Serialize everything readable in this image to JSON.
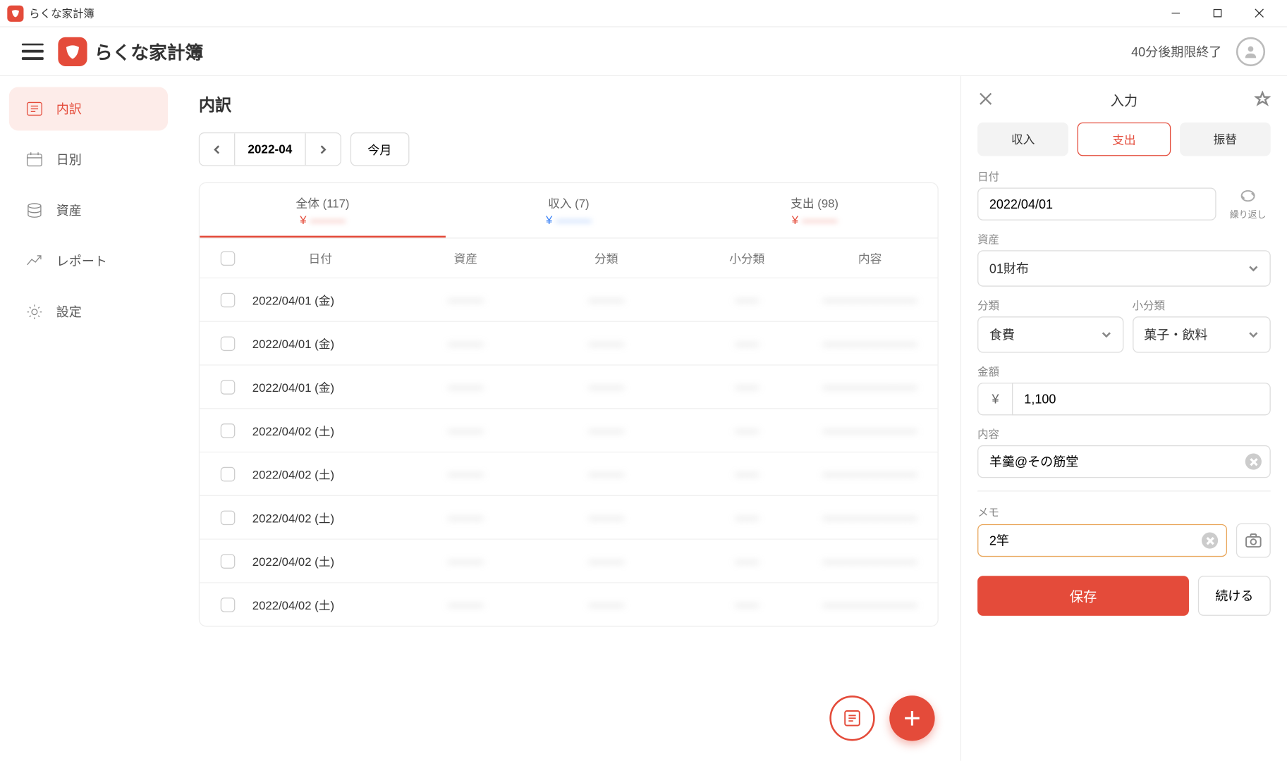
{
  "window": {
    "title": "らくな家計簿"
  },
  "header": {
    "app_name": "らくな家計簿",
    "expiry": "40分後期限終了"
  },
  "sidebar": {
    "items": [
      {
        "label": "内訳"
      },
      {
        "label": "日別"
      },
      {
        "label": "資産"
      },
      {
        "label": "レポート"
      },
      {
        "label": "設定"
      }
    ]
  },
  "main": {
    "page_title": "内訳",
    "period": "2022-04",
    "this_month": "今月",
    "summary": [
      {
        "label": "全体 (117)",
        "sign": "neg",
        "amount": "———"
      },
      {
        "label": "収入 (7)",
        "sign": "pos",
        "amount": "———"
      },
      {
        "label": "支出 (98)",
        "sign": "neg",
        "amount": "———"
      }
    ],
    "columns": {
      "date": "日付",
      "asset": "資産",
      "cat": "分類",
      "sub": "小分類",
      "desc": "内容"
    },
    "rows": [
      {
        "date": "2022/04/01 (金)"
      },
      {
        "date": "2022/04/01 (金)"
      },
      {
        "date": "2022/04/01 (金)"
      },
      {
        "date": "2022/04/02 (土)"
      },
      {
        "date": "2022/04/02 (土)"
      },
      {
        "date": "2022/04/02 (土)"
      },
      {
        "date": "2022/04/02 (土)"
      },
      {
        "date": "2022/04/02 (土)"
      }
    ]
  },
  "panel": {
    "title": "入力",
    "tabs": {
      "income": "収入",
      "expense": "支出",
      "transfer": "振替"
    },
    "labels": {
      "date": "日付",
      "repeat": "繰り返し",
      "asset": "資産",
      "category": "分類",
      "subcategory": "小分類",
      "amount": "金額",
      "desc": "内容",
      "memo": "メモ"
    },
    "values": {
      "date": "2022/04/01",
      "asset": "01財布",
      "category": "食費",
      "subcategory": "菓子・飲料",
      "currency": "¥",
      "amount": "1,100",
      "desc": "羊羹@その筋堂",
      "memo": "2竿"
    },
    "actions": {
      "save": "保存",
      "continue": "続ける"
    }
  }
}
